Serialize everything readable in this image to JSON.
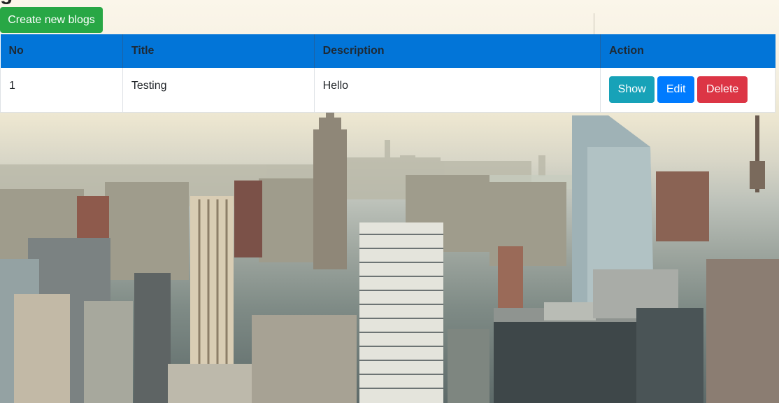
{
  "page": {
    "heading_partial": "g"
  },
  "toolbar": {
    "create_label": "Create new blogs"
  },
  "table": {
    "headers": [
      "No",
      "Title",
      "Description",
      "Action"
    ],
    "rows": [
      {
        "no": "1",
        "title": "Testing",
        "description": "Hello"
      }
    ],
    "actions": {
      "show_label": "Show",
      "edit_label": "Edit",
      "delete_label": "Delete"
    }
  },
  "colors": {
    "header_bg": "#0275d8",
    "create_button": "#28a745",
    "show_button": "#17a2b8",
    "edit_button": "#007bff",
    "delete_button": "#dc3545"
  },
  "background": {
    "image": "city-skyline-photo"
  }
}
